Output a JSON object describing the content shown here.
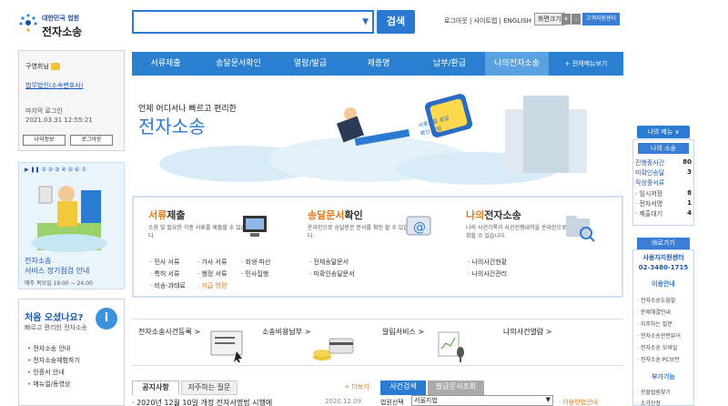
{
  "header": {
    "court_label": "대한민국 법원",
    "site_name": "전자소송",
    "util_links": "로그아웃 | 사이트맵 | ENGLISH",
    "zoom_label": "화면크기",
    "zoom_plus": "+",
    "zoom_minus": "-",
    "remote_support": "고객지원센터",
    "search_button": "검색"
  },
  "nav": {
    "items": [
      "서류제출",
      "송달문서확인",
      "열람/발급",
      "제증명",
      "납부/환급",
      "나의전자소송",
      "+ 전체메뉴보기"
    ]
  },
  "user": {
    "name": "구영회",
    "suffix": "님",
    "org": "법무법인(소속변호사)",
    "last_login_label": "마지막 로그인",
    "last_login_time": "2021.03.31 12:55:21",
    "my_info_btn": "나의정보",
    "logout_btn": "로그아웃"
  },
  "banner": {
    "controls": "▶ ❚❚ ① ② ③ ④ ⑤ ⑥ ⑦",
    "line1": "전자소송",
    "line2": "서비스 정기점검 안내",
    "line3": "매주 목요일 19:00 ~ 24:00"
  },
  "welcome": {
    "title": "처음 오셨나요?",
    "subtitle": "빠르고 편리한 전자소송",
    "links": [
      "전자소송 안내",
      "전자소송체험하기",
      "인증서 안내",
      "매뉴얼/동영상"
    ]
  },
  "hero": {
    "subtitle": "언제 어디서나 빠르고 편리한",
    "title": "전자소송",
    "screen_text": "서류제출 송달확인 열람"
  },
  "services": [
    {
      "title_main": "서류",
      "title_rest": "제출",
      "desc": "소장 및 필요한 각종 서류를 제출할 수 있습니다.",
      "links": [
        "· 민사 서류",
        "· 가사 서류",
        "· 회생·파산",
        "· 특허 서류",
        "· 행정 서류",
        "· 민사집행",
        "· 비송·과태료",
        "· 지급 명령"
      ]
    },
    {
      "title_main": "송달문서",
      "title_rest": "확인",
      "desc": "온라인으로 송달받은 문서를 확인 할 수 있습니다.",
      "links": [
        "· 전체송달문서",
        "· 미확인송달문서"
      ]
    },
    {
      "title_main": "나의",
      "title_rest": "전자소송",
      "desc": "나의 사건기록과 사건진행내역을 온라인으로 조회할 수 있습니다.",
      "links": [
        "· 나의사건현황",
        "· 나의사건관리"
      ]
    }
  ],
  "shortcuts": [
    "전자소송사건등록 >",
    "소송비용납부 >",
    "알림서비스 >",
    "나의사건열람 >"
  ],
  "bottom": {
    "tabs": [
      "공지사항",
      "자주하는 질문"
    ],
    "more": "+ 더보기",
    "tabs2": [
      "사건검색",
      "발급문서조회"
    ],
    "notice": "· 2020년 12월 10일 개정 전자서명법 시행에",
    "notice_date": "2020.12.09",
    "court_select_label": "법원선택",
    "court_select_value": "서울지법",
    "search_hint": "· 이용방법안내"
  },
  "right": {
    "my_menu": "나의 메뉴 ∨",
    "my_litig": "나의 소송",
    "rows": [
      {
        "label": "진행중사건",
        "n": "80",
        "color": "#1c57b5"
      },
      {
        "label": "미확인송달",
        "n": "3",
        "color": "#1c57b5"
      },
      {
        "label": "작성중서류",
        "n": "",
        "color": "#1c57b5"
      },
      {
        "label": "· 임시저장",
        "n": "8",
        "color": "#444"
      },
      {
        "label": "· 전자서명",
        "n": "1",
        "color": "#444"
      },
      {
        "label": "· 제출대기",
        "n": "4",
        "color": "#444"
      }
    ],
    "shortcut": "바로가기",
    "helpdesk": "사용자지원센터",
    "phone": "02-3480-1715",
    "usage_guide": "이용안내",
    "usage_items": [
      "· 전자소송도움말",
      "· 문제해결안내",
      "· 자주하는 질문",
      "· 전자소송관련뷰어",
      "· 전자소송 모바일",
      "· 전자소송 PC보안"
    ],
    "extra": "부가기능",
    "extra_items": [
      "· 관할법원찾기",
      "· 소가산정"
    ]
  }
}
